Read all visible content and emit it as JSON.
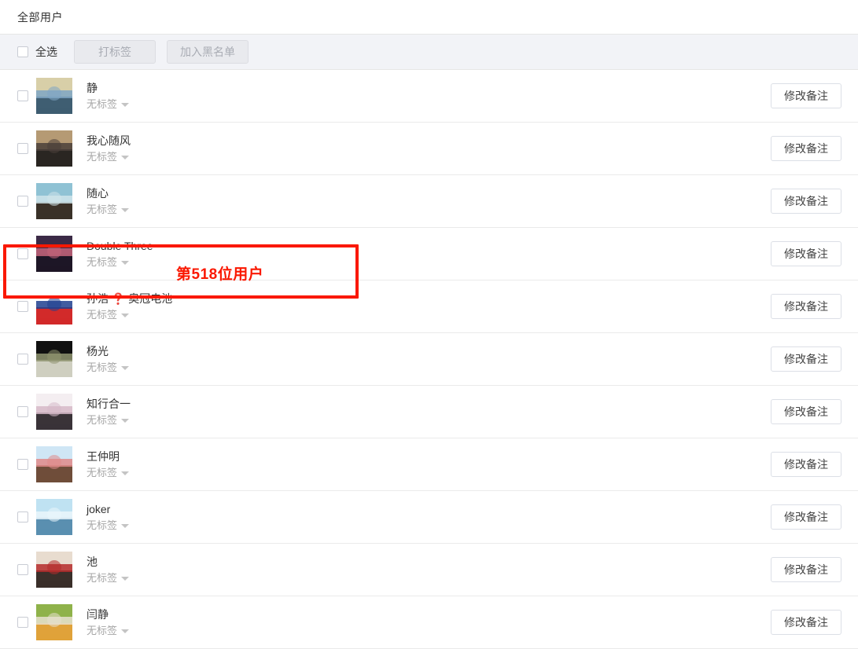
{
  "header": {
    "title": "全部用户"
  },
  "toolbar": {
    "select_all_label": "全选",
    "tag_button_label": "打标签",
    "blacklist_button_label": "加入黑名单"
  },
  "list": {
    "tag_placeholder": "无标签",
    "remark_button_label": "修改备注",
    "rows": [
      {
        "name": "静",
        "tag": "无标签",
        "avatar": "road-landscape",
        "colors": [
          "#d8cfa8",
          "#7fa6c4",
          "#3f5e72"
        ]
      },
      {
        "name": "我心随风",
        "tag": "无标签",
        "avatar": "man-in-shop",
        "colors": [
          "#b59a74",
          "#4a3f3a",
          "#2a2622"
        ]
      },
      {
        "name": "随心",
        "tag": "无标签",
        "avatar": "sea-sunset",
        "colors": [
          "#8fc2d4",
          "#cfe4ea",
          "#3a3128"
        ]
      },
      {
        "name": "Double Three",
        "tag": "无标签",
        "avatar": "window-cartoon",
        "colors": [
          "#3b2a46",
          "#c4647a",
          "#1d1626"
        ]
      },
      {
        "name": "孙浩 ❓ 奥冠电池",
        "tag": "无标签",
        "avatar": "battery-logo",
        "colors": [
          "#ffffff",
          "#1f3f8f",
          "#d22a2a"
        ]
      },
      {
        "name": "杨光",
        "tag": "无标签",
        "avatar": "coin-photo",
        "colors": [
          "#101010",
          "#8f9470",
          "#cfcfc0"
        ]
      },
      {
        "name": "知行合一",
        "tag": "无标签",
        "avatar": "seal-ren",
        "colors": [
          "#f4eef1",
          "#d6b9c8",
          "#3a3338"
        ]
      },
      {
        "name": "王仲明",
        "tag": "无标签",
        "avatar": "cartoon-couple",
        "colors": [
          "#cfe6f5",
          "#e08a8a",
          "#6f4d3a"
        ]
      },
      {
        "name": "joker",
        "tag": "无标签",
        "avatar": "anime-white",
        "colors": [
          "#bfe2f2",
          "#eaf6fb",
          "#5a8fb0"
        ]
      },
      {
        "name": "池",
        "tag": "无标签",
        "avatar": "red-jacket",
        "colors": [
          "#e8dccf",
          "#b52b2b",
          "#3a2f2a"
        ]
      },
      {
        "name": "闫静",
        "tag": "无标签",
        "avatar": "toy-plant",
        "colors": [
          "#8fb24a",
          "#e8e0cf",
          "#e0a23a"
        ]
      }
    ]
  },
  "annotation": {
    "text": "第518位用户",
    "color": "#fa1800",
    "target_row_index": 2
  }
}
